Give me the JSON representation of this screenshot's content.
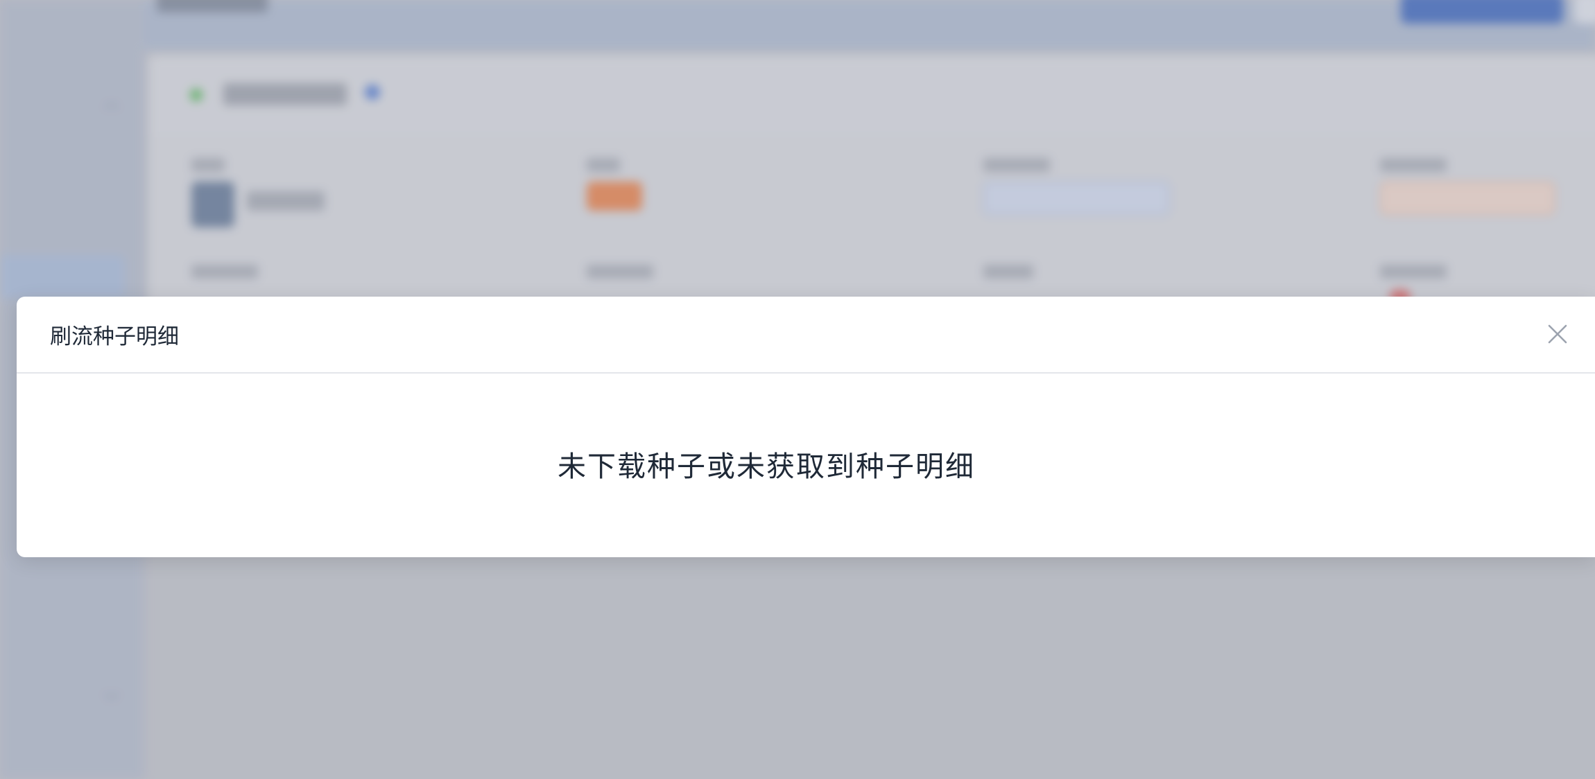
{
  "dialog": {
    "title": "刷流种子明细",
    "empty_message": "未下载种子或未获取到种子明细",
    "close_icon": "close-icon"
  },
  "colors": {
    "overlay": "#b8bbc3",
    "dialog_bg": "#ffffff",
    "text_primary": "#1f2937",
    "close_icon": "#9ca3af"
  }
}
